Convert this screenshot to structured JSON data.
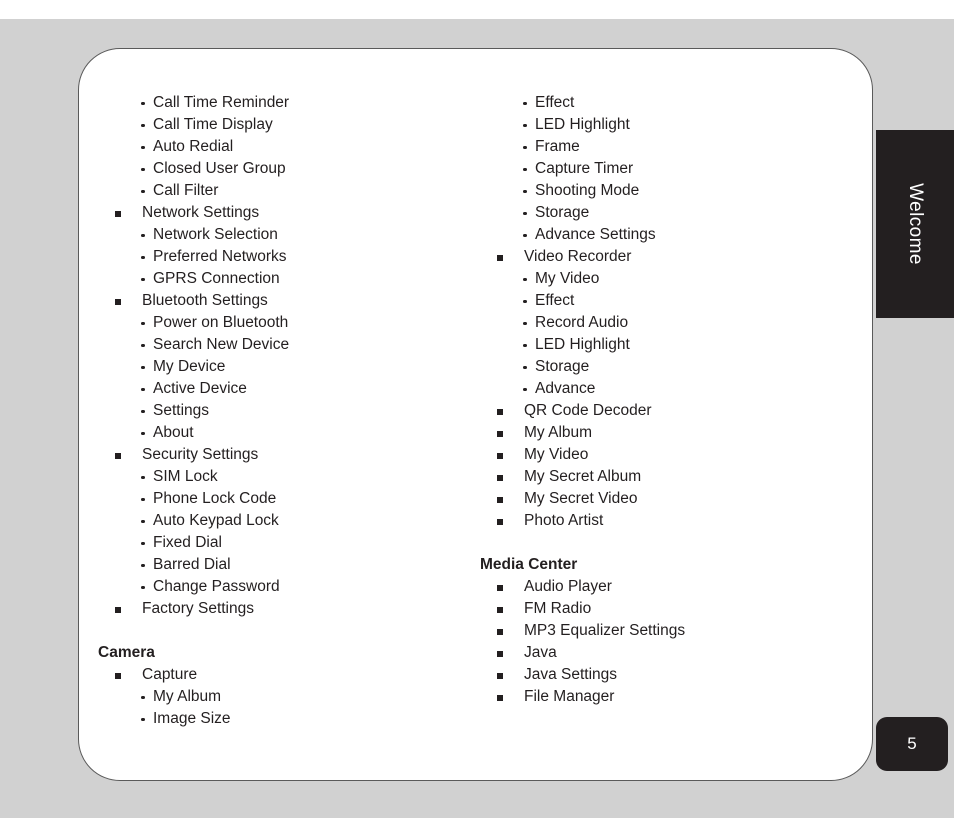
{
  "page": {
    "badge_number": "5",
    "side_tab_label": "Welcome"
  },
  "colors": {
    "backdrop": "#d1d1d1",
    "sheet": "#ffffff",
    "sheet_border": "#5a5a5a",
    "tab_background": "#231f20",
    "tab_text": "#ffffff",
    "body_text": "#231f20"
  },
  "left_column": {
    "continued_sub_items": [
      "Call Time Reminder",
      "Call Time Display",
      "Auto Redial",
      "Closed User Group",
      "Call Filter"
    ],
    "groups": [
      {
        "label": "Network Settings",
        "children": [
          "Network Selection",
          "Preferred Networks",
          "GPRS Connection"
        ]
      },
      {
        "label": "Bluetooth Settings",
        "children": [
          "Power on Bluetooth",
          "Search New Device",
          "My Device",
          "Active Device",
          "Settings",
          "About"
        ]
      },
      {
        "label": "Security Settings",
        "children": [
          "SIM Lock",
          "Phone Lock Code",
          "Auto Keypad Lock",
          "Fixed Dial",
          "Barred Dial",
          "Change Password"
        ]
      },
      {
        "label": "Factory Settings",
        "children": []
      }
    ],
    "section": {
      "heading": "Camera",
      "groups": [
        {
          "label": "Capture",
          "children": [
            "My Album",
            "Image Size"
          ]
        }
      ]
    }
  },
  "right_column": {
    "continued_sub_items": [
      "Effect",
      "LED Highlight",
      "Frame",
      "Capture Timer",
      "Shooting Mode",
      "Storage",
      "Advance Settings"
    ],
    "groups": [
      {
        "label": "Video Recorder",
        "children": [
          "My Video",
          "Effect",
          "Record Audio",
          "LED Highlight",
          "Storage",
          "Advance"
        ]
      },
      {
        "label": "QR Code Decoder",
        "children": []
      },
      {
        "label": "My Album",
        "children": []
      },
      {
        "label": "My Video",
        "children": []
      },
      {
        "label": "My Secret Album",
        "children": []
      },
      {
        "label": "My Secret Video",
        "children": []
      },
      {
        "label": "Photo Artist",
        "children": []
      }
    ],
    "section": {
      "heading": "Media Center",
      "groups": [
        {
          "label": "Audio Player",
          "children": []
        },
        {
          "label": "FM Radio",
          "children": []
        },
        {
          "label": "MP3 Equalizer Settings",
          "children": []
        },
        {
          "label": "Java",
          "children": []
        },
        {
          "label": "Java Settings",
          "children": []
        },
        {
          "label": "File Manager",
          "children": []
        }
      ]
    }
  }
}
